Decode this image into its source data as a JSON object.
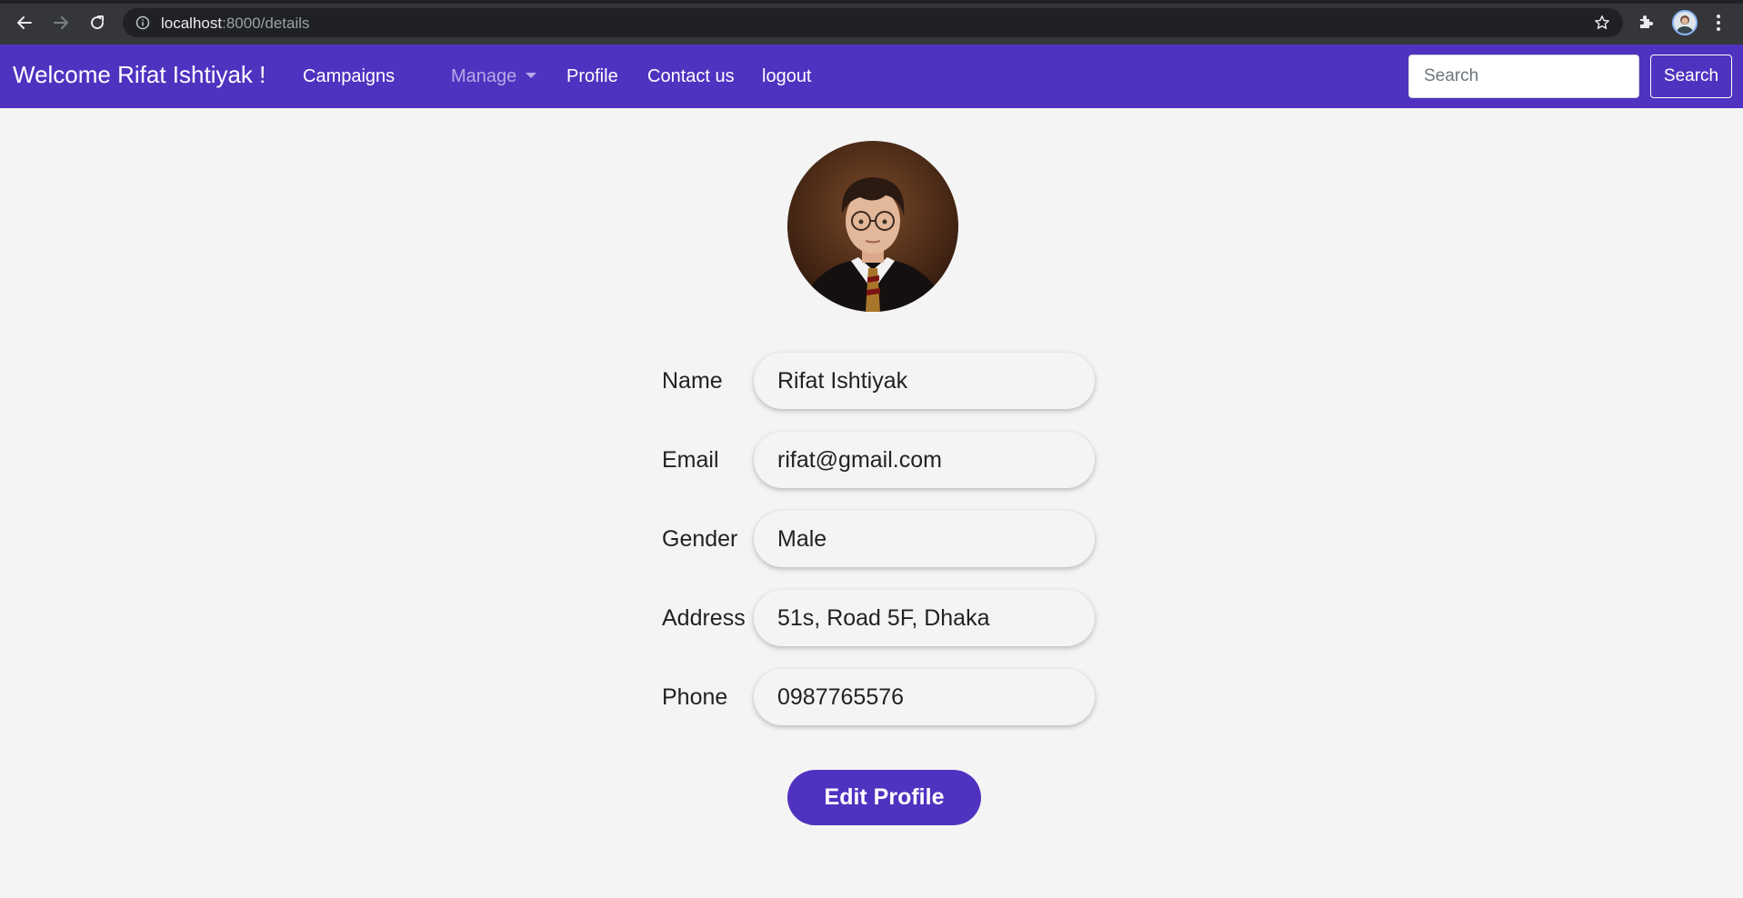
{
  "browser": {
    "url_host": "localhost",
    "url_path": ":8000/details"
  },
  "navbar": {
    "brand": "Welcome Rifat Ishtiyak !",
    "links": {
      "campaigns": "Campaigns",
      "manage": "Manage",
      "profile": "Profile",
      "contact": "Contact us",
      "logout": "logout"
    },
    "search_placeholder": "Search",
    "search_button": "Search",
    "color": "#5032c0"
  },
  "profile": {
    "fields": [
      {
        "label": "Name",
        "value": "Rifat Ishtiyak"
      },
      {
        "label": "Email",
        "value": "rifat@gmail.com"
      },
      {
        "label": "Gender",
        "value": "Male"
      },
      {
        "label": "Address",
        "value": "51s, Road 5F, Dhaka"
      },
      {
        "label": "Phone",
        "value": "0987765576"
      }
    ],
    "edit_button": "Edit Profile"
  }
}
